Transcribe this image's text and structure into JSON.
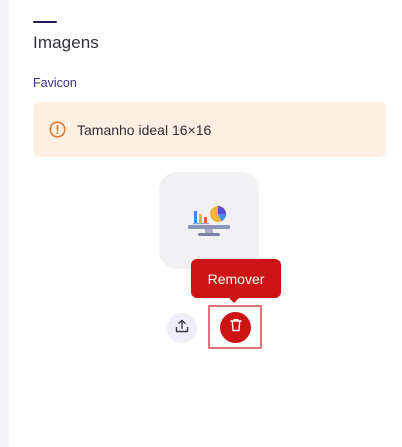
{
  "section": {
    "title": "Imagens"
  },
  "favicon": {
    "label": "Favicon",
    "alert": {
      "icon": "alert-circle-icon",
      "text": "Tamanho ideal 16×16",
      "background": "#fdf0e2",
      "icon_color": "#e07a2a"
    },
    "preview": {
      "icon": "monitor-chart-icon"
    },
    "actions": {
      "upload_icon": "upload-icon",
      "remove_icon": "trash-icon",
      "tooltip": "Remover"
    }
  },
  "colors": {
    "accent": "#1f1d4d",
    "label": "#3a2f8c",
    "danger": "#cc1414",
    "highlight": "#e0727a"
  }
}
